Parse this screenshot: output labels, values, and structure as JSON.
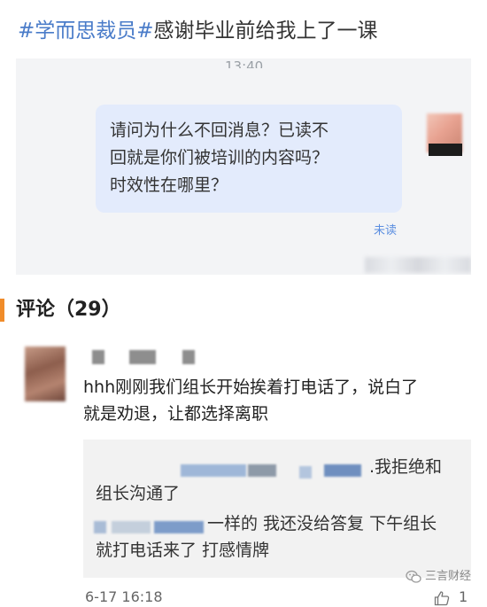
{
  "headline": {
    "tags": "#学而思裁员#",
    "text": "感谢毕业前给我上了一课"
  },
  "chat": {
    "time": "13:40",
    "message_lines": [
      "请问为什么不回消息？已读不",
      "回就是你们被培训的内容吗？",
      "时效性在哪里？"
    ],
    "status": "未读"
  },
  "comments": {
    "title": "评论（29）",
    "accent_color": "#f08c2a"
  },
  "comment": {
    "text_lines": [
      "hhh刚刚我们组长开始挨着打电话了，说白了",
      "就是劝退，让都选择离职"
    ],
    "replies": {
      "line1_visible": ".我拒绝和",
      "line2": "组长沟通了",
      "line3_visible": "一样的 我还没给答复 下午组长",
      "line4": "就打电话来了 打感情牌"
    },
    "timestamp": "6-17 16:18",
    "like_count": "1"
  },
  "watermark": {
    "text": "三言财经",
    "icon": "wechat-icon"
  },
  "colors": {
    "tag": "#4a7cc9",
    "bubble": "#e3ebfc",
    "unread": "#5b8ee0"
  }
}
